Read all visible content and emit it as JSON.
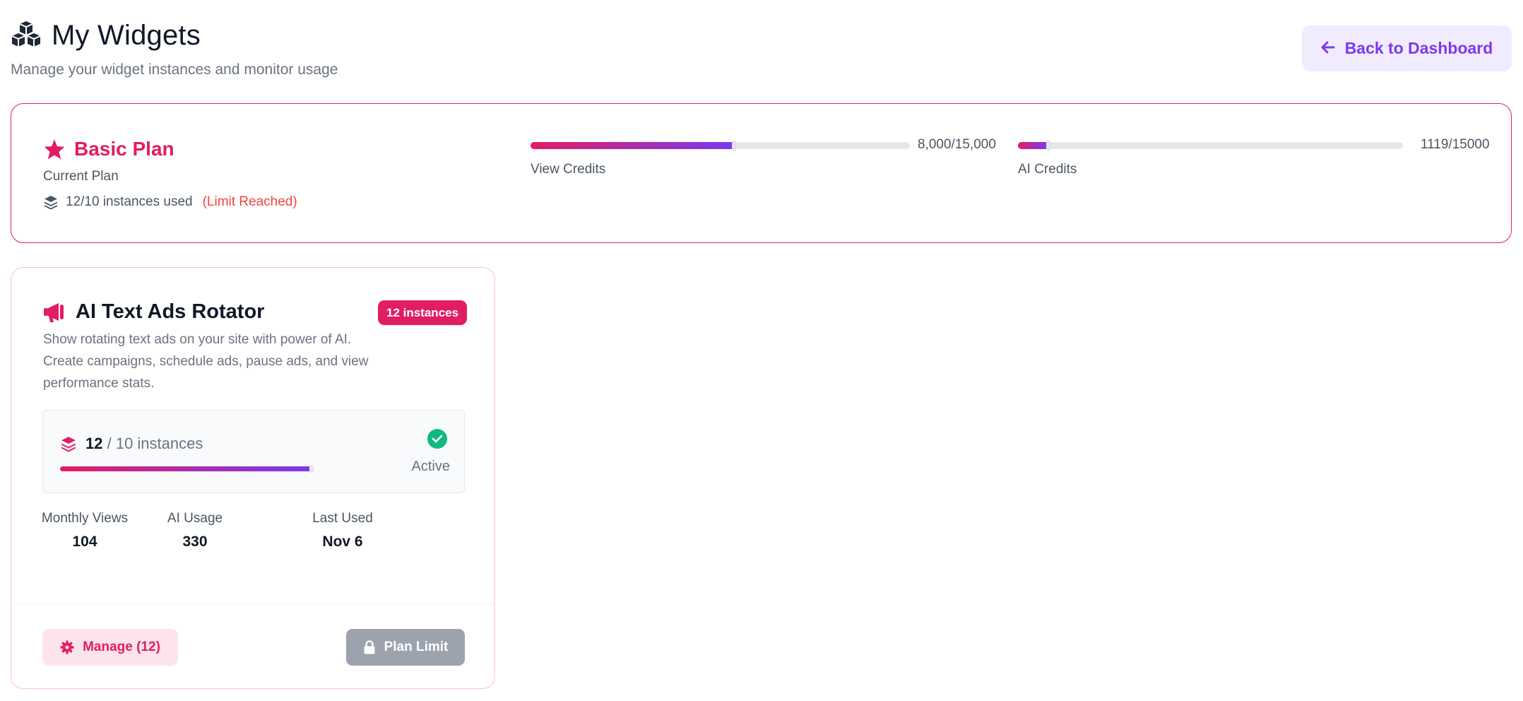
{
  "header": {
    "title": "My Widgets",
    "subtitle": "Manage your widget instances and monitor usage",
    "back_label": "Back to Dashboard"
  },
  "plan": {
    "name": "Basic Plan",
    "sub": "Current Plan",
    "instances_text": "12/10 instances used",
    "limit_text": "(Limit Reached)",
    "view_credits": {
      "label": "View Credits",
      "value_text": "8,000/15,000",
      "used": 8000,
      "total": 15000
    },
    "ai_credits": {
      "label": "AI Credits",
      "value_text": "1119/15000",
      "used": 1119,
      "total": 15000
    }
  },
  "widget": {
    "title": "AI Text Ads Rotator",
    "badge": "12 instances",
    "description": "Show rotating text ads on your site with power of AI. Create campaigns, schedule ads, pause ads, and view performance stats.",
    "instances_used": "12",
    "instances_total": "/ 10 instances",
    "status": "Active",
    "stats": [
      {
        "label": "Monthly Views",
        "value": "104"
      },
      {
        "label": "AI Usage",
        "value": "330"
      },
      {
        "label": "Last Used",
        "value": "Nov 6"
      }
    ],
    "manage_label": "Manage (12)",
    "limit_label": "Plan Limit"
  },
  "colors": {
    "accent_pink": "#e11d63",
    "accent_purple": "#7c3aed",
    "success": "#10b981",
    "danger": "#ef4444"
  },
  "icons": [
    "cubes-icon",
    "arrow-left-icon",
    "star-icon",
    "layers-icon",
    "megaphone-icon",
    "check-circle-icon",
    "gear-icon",
    "lock-icon"
  ]
}
